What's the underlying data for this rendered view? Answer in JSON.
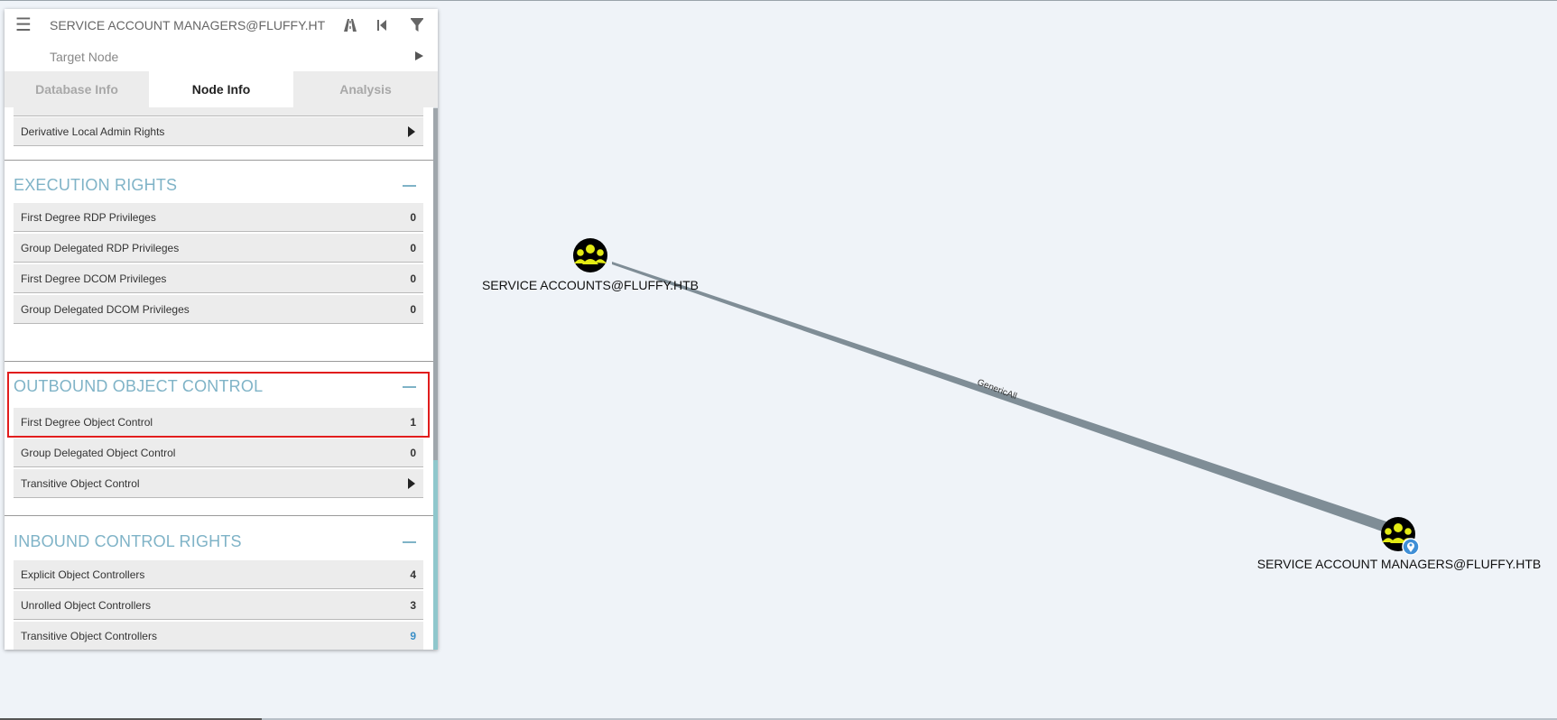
{
  "search": {
    "value": "SERVICE ACCOUNT MANAGERS@FLUFFY.HTB",
    "target_placeholder": "Target Node"
  },
  "toolbar": {
    "icons": [
      "menu-icon",
      "pathfinding-road-icon",
      "back-icon",
      "filter-icon",
      "play-icon"
    ]
  },
  "tabs": [
    {
      "label": "Database Info",
      "active": false
    },
    {
      "label": "Node Info",
      "active": true
    },
    {
      "label": "Analysis",
      "active": false
    }
  ],
  "partial_row": {
    "label": "Derivative Local Admin Rights"
  },
  "sections": {
    "execution": {
      "title": "EXECUTION RIGHTS",
      "rows": [
        {
          "label": "First Degree RDP Privileges",
          "count": "0"
        },
        {
          "label": "Group Delegated RDP Privileges",
          "count": "0"
        },
        {
          "label": "First Degree DCOM Privileges",
          "count": "0"
        },
        {
          "label": "Group Delegated DCOM Privileges",
          "count": "0"
        }
      ]
    },
    "outbound": {
      "title": "OUTBOUND OBJECT CONTROL",
      "rows": [
        {
          "label": "First Degree Object Control",
          "count": "1"
        },
        {
          "label": "Group Delegated Object Control",
          "count": "0"
        },
        {
          "label": "Transitive Object Control"
        }
      ]
    },
    "inbound": {
      "title": "INBOUND CONTROL RIGHTS",
      "rows": [
        {
          "label": "Explicit Object Controllers",
          "count": "4"
        },
        {
          "label": "Unrolled Object Controllers",
          "count": "3"
        },
        {
          "label": "Transitive Object Controllers",
          "count": "9"
        }
      ]
    }
  },
  "graph": {
    "nodes": [
      {
        "label": "SERVICE ACCOUNTS@FLUFFY.HTB",
        "type": "group-icon"
      },
      {
        "label": "SERVICE ACCOUNT MANAGERS@FLUFFY.HTB",
        "type": "group-icon",
        "marker": "map-pin-icon"
      }
    ],
    "edge_label": "GenericAll"
  },
  "colors": {
    "background": "#eff3f8",
    "accent": "#7fb3c7",
    "highlight": "#e11d1d",
    "node_fill": "#d7e31a",
    "edge": "#7a8a94",
    "link_count": "#3a8fc7"
  }
}
